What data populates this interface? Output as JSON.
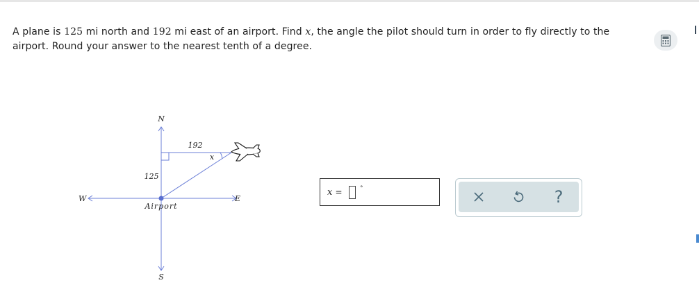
{
  "question": {
    "line1": {
      "seg1": "A plane is ",
      "north_value": "125",
      "seg2": " mi north and ",
      "east_value": "192",
      "seg3": " mi east of an airport. Find ",
      "variable": "x",
      "seg4": ", the angle the pilot should turn in order to fly directly to the"
    },
    "line2": "airport. Round your answer to the nearest tenth of a degree."
  },
  "diagram": {
    "north_label": "N",
    "south_label": "S",
    "west_label": "W",
    "east_label": "E",
    "origin_label": "Airport",
    "north_distance_label": "125",
    "east_distance_label": "192",
    "angle_label": "x",
    "line_color": "#6b7fd7",
    "origin_color": "#5a6fd0"
  },
  "answer": {
    "variable": "x",
    "equals": "=",
    "degree_symbol": "°",
    "value": ""
  },
  "tools": {
    "clear_icon": "close-icon",
    "undo_icon": "undo-icon",
    "help_label": "?"
  },
  "colors": {
    "accent": "#4a6a7a",
    "panel_bg": "#d6e1e4",
    "panel_border": "#b9c9cf"
  }
}
